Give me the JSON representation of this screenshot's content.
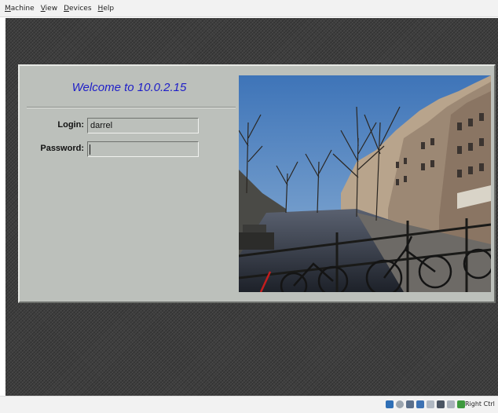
{
  "menubar": {
    "items": [
      {
        "label": "Machine",
        "underline": "M",
        "rest": "achine"
      },
      {
        "label": "View",
        "underline": "V",
        "rest": "iew"
      },
      {
        "label": "Devices",
        "underline": "D",
        "rest": "evices"
      },
      {
        "label": "Help",
        "underline": "H",
        "rest": "elp"
      }
    ]
  },
  "login_dialog": {
    "welcome": "Welcome to 10.0.2.15",
    "login_label": "Login:",
    "login_value": "darrel",
    "password_label": "Password:",
    "password_value": ""
  },
  "photo": {
    "description_icon": "amsterdam-canal-photo",
    "sky_color": "#4f80c0"
  },
  "statusbar": {
    "icons": [
      "hard-disk-icon",
      "optical-drive-icon",
      "usb-icon",
      "network-icon",
      "shared-folder-icon",
      "display-icon",
      "mouse-integration-icon",
      "host-key-icon"
    ],
    "host_key_label": "Right Ctrl"
  },
  "colors": {
    "dialog_bg": "#bcc0bb",
    "welcome_text": "#1e1ec8",
    "screen_bg": "#3f3f3f"
  }
}
